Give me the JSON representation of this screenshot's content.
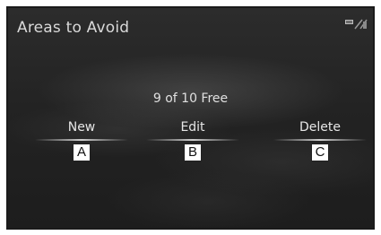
{
  "screen": {
    "title": "Areas to Avoid",
    "status_icon": "signal-status-icon",
    "free_count": "9 of 10 Free"
  },
  "options": [
    {
      "label": "New",
      "callout": "A"
    },
    {
      "label": "Edit",
      "callout": "B"
    },
    {
      "label": "Delete",
      "callout": "C"
    }
  ]
}
